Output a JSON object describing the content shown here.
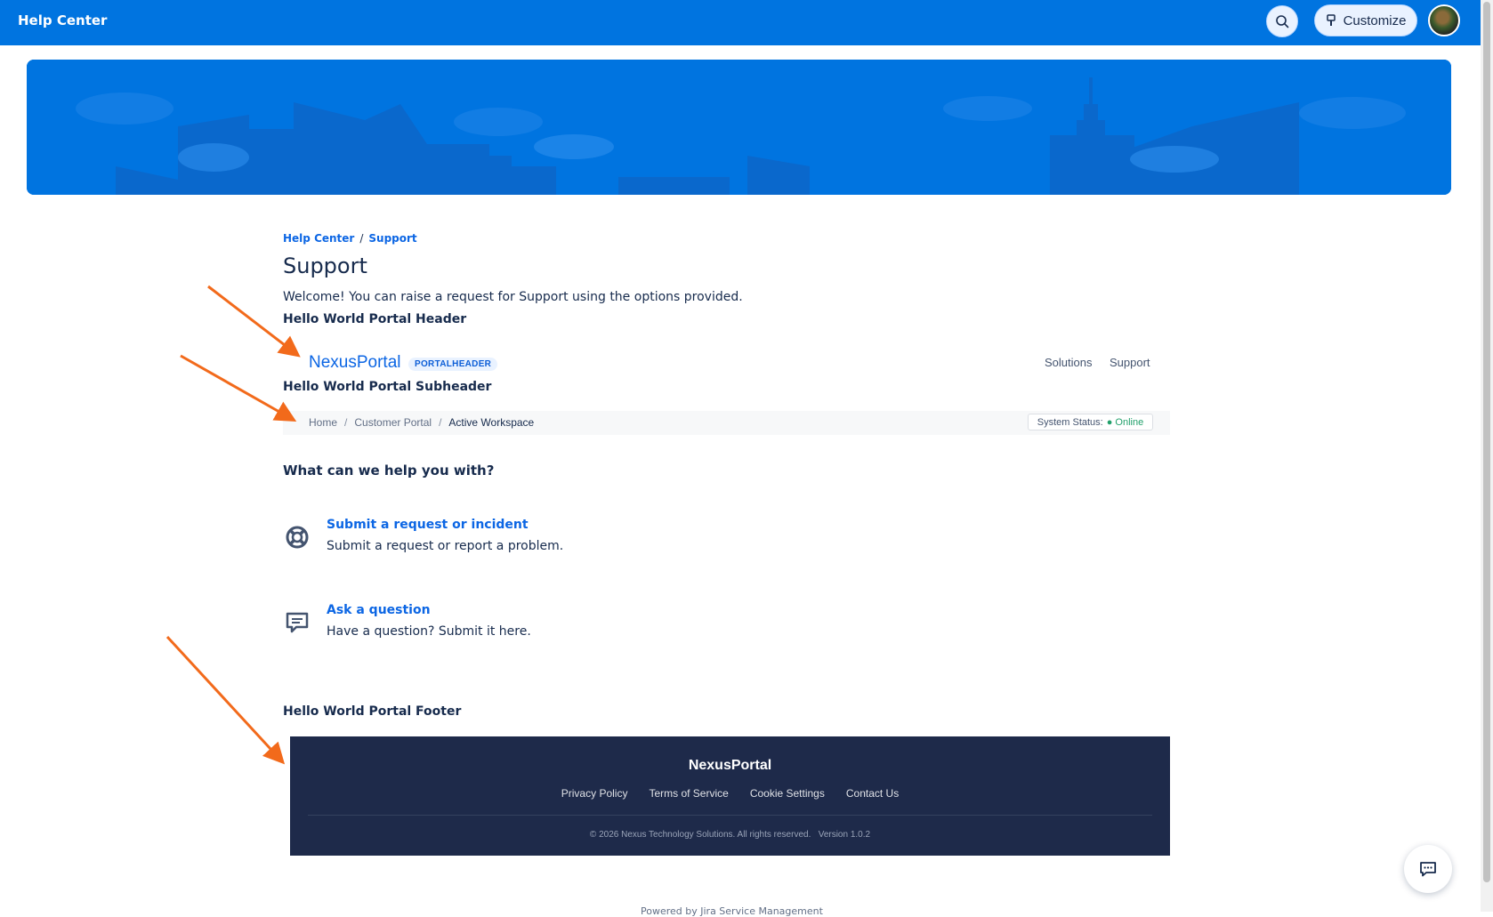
{
  "topbar": {
    "title": "Help Center",
    "customize_label": "Customize",
    "search_icon": "search-icon",
    "customize_icon": "paint-brush-icon"
  },
  "breadcrumb": {
    "items": [
      "Help Center",
      "Support"
    ],
    "separator": "/"
  },
  "page": {
    "title": "Support",
    "welcome": "Welcome! You can raise a request for Support using the options provided.",
    "portal_header_label": "Hello World Portal Header",
    "portal_subheader_label": "Hello World Portal Subheader",
    "portal_footer_label": "Hello World Portal Footer",
    "help_heading": "What can we help you with?"
  },
  "portal_header": {
    "logo": "NexusPortal",
    "badge": "PORTALHEADER",
    "nav": [
      "Solutions",
      "Support"
    ]
  },
  "portal_subheader": {
    "crumbs": [
      "Home",
      "Customer Portal",
      "Active Workspace"
    ],
    "separator": "/",
    "status_label": "System Status:",
    "status_value": "● Online"
  },
  "options": [
    {
      "title": "Submit a request or incident",
      "description": "Submit a request or report a problem.",
      "icon": "lifebuoy-icon"
    },
    {
      "title": "Ask a question",
      "description": "Have a question? Submit it here.",
      "icon": "chat-message-icon"
    }
  ],
  "portal_footer": {
    "brand": "NexusPortal",
    "links": [
      "Privacy Policy",
      "Terms of Service",
      "Cookie Settings",
      "Contact Us"
    ],
    "copyright": "© 2026 Nexus Technology Solutions. All rights reserved.",
    "version": "Version 1.0.2"
  },
  "powered_by": "Powered by Jira Service Management",
  "colors": {
    "brand_blue": "#0074e0",
    "link_blue": "#0c66e4",
    "footer_bg": "#1e2a4a",
    "annotation_arrow": "#f26a1b",
    "status_online": "#22a06b"
  }
}
